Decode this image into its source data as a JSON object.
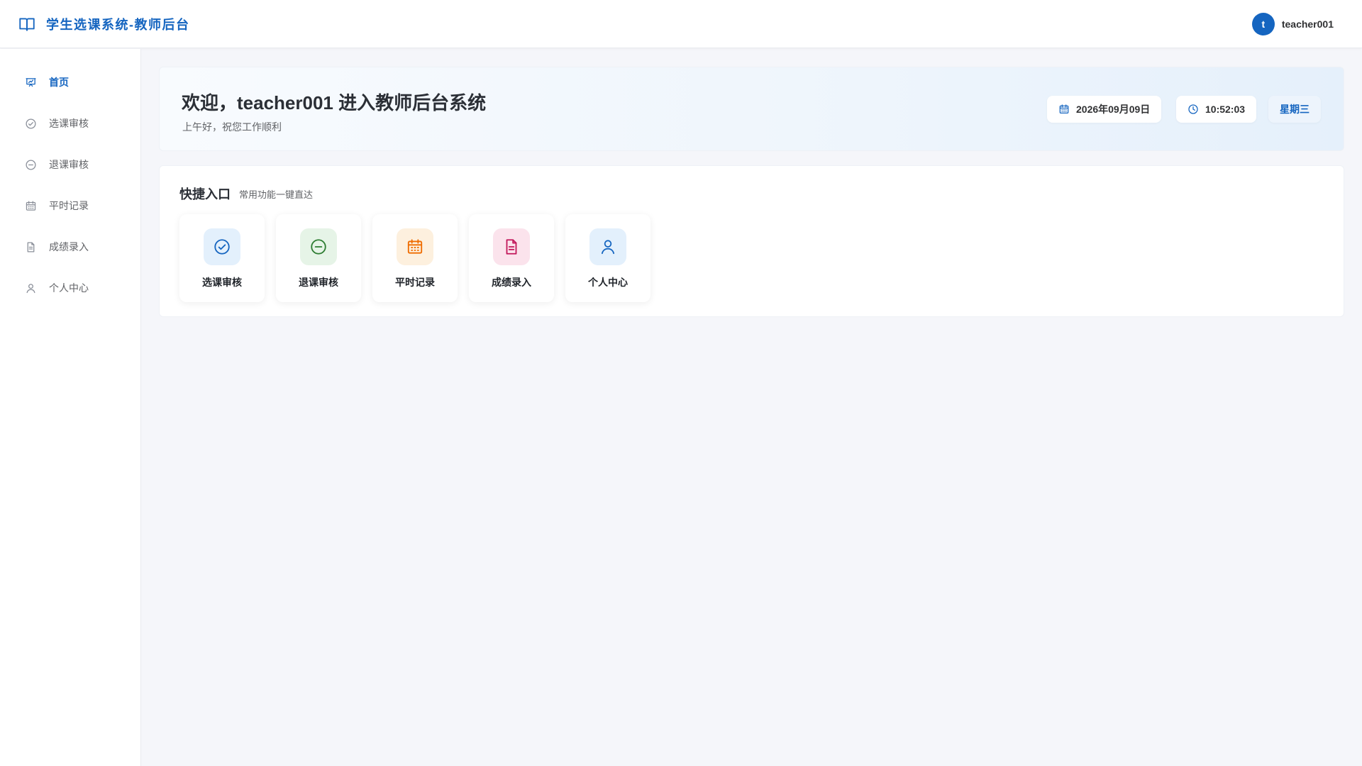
{
  "header": {
    "title": "学生选课系统-教师后台",
    "avatar_letter": "t",
    "username": "teacher001"
  },
  "sidebar": {
    "items": [
      {
        "label": "首页",
        "icon": "presentation-chart-icon",
        "active": true
      },
      {
        "label": "选课审核",
        "icon": "check-circle-icon",
        "active": false
      },
      {
        "label": "退课审核",
        "icon": "minus-circle-icon",
        "active": false
      },
      {
        "label": "平时记录",
        "icon": "calendar-icon",
        "active": false
      },
      {
        "label": "成绩录入",
        "icon": "document-icon",
        "active": false
      },
      {
        "label": "个人中心",
        "icon": "user-icon",
        "active": false
      }
    ]
  },
  "welcome": {
    "title": "欢迎，teacher001 进入教师后台系统",
    "subtitle": "上午好，祝您工作顺利",
    "date": "2026年09月09日",
    "time": "10:52:03",
    "weekday": "星期三"
  },
  "quick": {
    "title": "快捷入口",
    "subtitle": "常用功能一键直达",
    "cards": [
      {
        "label": "选课审核",
        "icon": "check-circle-icon",
        "color": "#1565c0",
        "bg": "#e3f0fc"
      },
      {
        "label": "退课审核",
        "icon": "minus-circle-icon",
        "color": "#2e7d32",
        "bg": "#e6f4e7"
      },
      {
        "label": "平时记录",
        "icon": "calendar-icon",
        "color": "#ef6c00",
        "bg": "#fdf0de"
      },
      {
        "label": "成绩录入",
        "icon": "document-icon",
        "color": "#c2185b",
        "bg": "#fbe3ec"
      },
      {
        "label": "个人中心",
        "icon": "user-icon",
        "color": "#1565c0",
        "bg": "#e3f0fc"
      }
    ]
  },
  "colors": {
    "primary": "#1565c0",
    "background": "#f5f6fa"
  }
}
